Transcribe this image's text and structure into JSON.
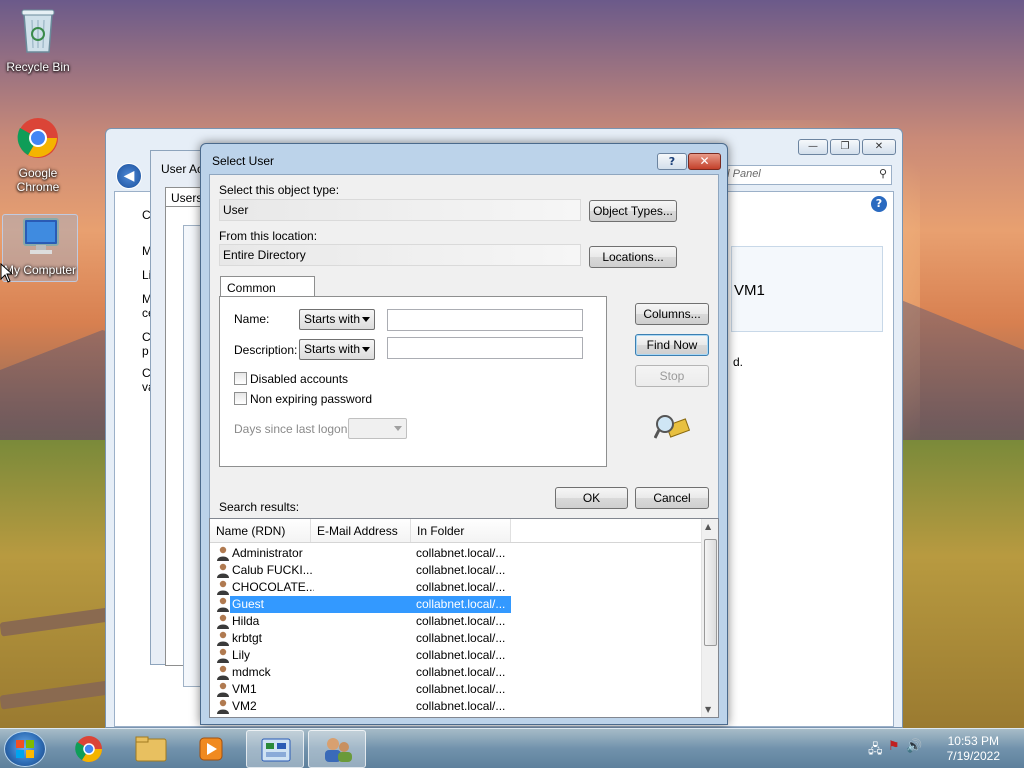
{
  "desktop": {
    "icons": [
      {
        "label": "Recycle Bin"
      },
      {
        "label": "Google Chrome"
      },
      {
        "label": "My Computer"
      }
    ]
  },
  "background_window": {
    "search_placeholder": "ol Panel",
    "side_letters": [
      "C",
      "M",
      "Li",
      "M",
      "ce",
      "C",
      "p",
      "C",
      "va"
    ],
    "partial_text": "VM1",
    "partial_text2": "d.",
    "user_accounts_title": "User Ac",
    "users_tab": "Users"
  },
  "dialog": {
    "title": "Select User",
    "object_type_label": "Select this object type:",
    "object_type_value": "User",
    "object_types_button": "Object Types...",
    "location_label": "From this location:",
    "location_value": "Entire Directory",
    "locations_button": "Locations...",
    "tab_label": "Common Queries",
    "name_label": "Name:",
    "name_combo": "Starts with",
    "description_label": "Description:",
    "description_combo": "Starts with",
    "disabled_accounts": "Disabled accounts",
    "non_expiring_password": "Non expiring password",
    "days_since_logon": "Days since last logon:",
    "columns_button": "Columns...",
    "find_now_button": "Find Now",
    "stop_button": "Stop",
    "ok_button": "OK",
    "cancel_button": "Cancel",
    "search_results_label": "Search results:",
    "columns": [
      "Name (RDN)",
      "E-Mail Address",
      "In Folder"
    ],
    "rows": [
      {
        "name": "Administrator",
        "email": "",
        "folder": "collabnet.local/..."
      },
      {
        "name": "Calub FUCKI...",
        "email": "",
        "folder": "collabnet.local/..."
      },
      {
        "name": "CHOCOLATE...",
        "email": "",
        "folder": "collabnet.local/..."
      },
      {
        "name": "Guest",
        "email": "",
        "folder": "collabnet.local/...",
        "selected": true
      },
      {
        "name": "Hilda",
        "email": "",
        "folder": "collabnet.local/..."
      },
      {
        "name": "krbtgt",
        "email": "",
        "folder": "collabnet.local/..."
      },
      {
        "name": "Lily",
        "email": "",
        "folder": "collabnet.local/..."
      },
      {
        "name": "mdmck",
        "email": "",
        "folder": "collabnet.local/..."
      },
      {
        "name": "VM1",
        "email": "",
        "folder": "collabnet.local/..."
      },
      {
        "name": "VM2",
        "email": "",
        "folder": "collabnet.local/..."
      }
    ]
  },
  "taskbar": {
    "time": "10:53 PM",
    "date": "7/19/2022"
  },
  "colors": {
    "selection": "#3399ff",
    "dialog_frame": "#bcd3ea",
    "taskbar": "#6e96b9"
  }
}
